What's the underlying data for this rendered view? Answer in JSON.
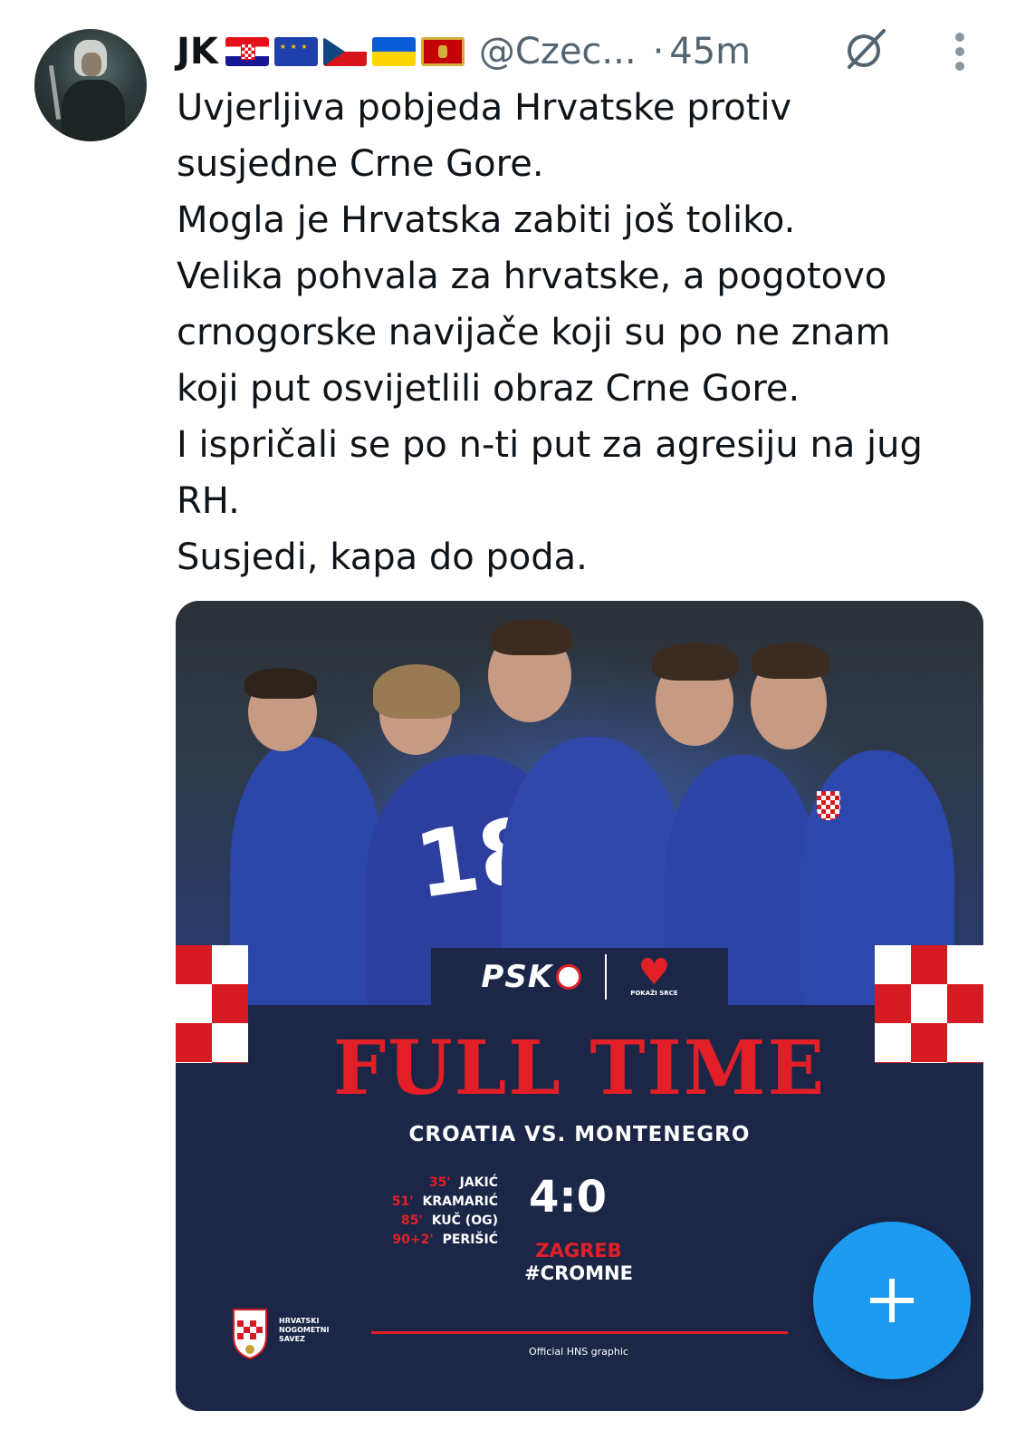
{
  "tweet": {
    "author": {
      "display_name": "JK",
      "flags": [
        "croatia-flag",
        "eu-flag",
        "czech-flag",
        "ukraine-flag",
        "montenegro-flag"
      ],
      "handle": "@Czec...",
      "time_sep": "·",
      "time": "45m"
    },
    "text_lines": [
      "Uvjerljiva pobjeda Hrvatske protiv",
      "susjedne Crne Gore.",
      "Mogla je Hrvatska zabiti još toliko.",
      "Velika pohvala za hrvatske, a pogotovo",
      "crnogorske navijače koji su po ne znam",
      "koji put osvijetlili obraz Crne Gore.",
      "I ispričali se po n-ti put za agresiju na jug",
      "RH.",
      "Susjedi, kapa do poda."
    ]
  },
  "graphic": {
    "sponsor": "PSK",
    "sponsor_sub": "POKAŽI SRCE",
    "headline": "FULL TIME",
    "match": "CROATIA VS. MONTENEGRO",
    "scorers": [
      {
        "min": "35'",
        "name": "JAKIĆ"
      },
      {
        "min": "51'",
        "name": "KRAMARIĆ"
      },
      {
        "min": "85'",
        "name": "KUČ (OG)"
      },
      {
        "min": "90+2'",
        "name": "PERIŠIĆ"
      }
    ],
    "score": "4:0",
    "city": "ZAGREB",
    "hashtag": "#CROMNE",
    "federation": [
      "HRVATSKI",
      "NOGOMETNI",
      "SAVEZ"
    ],
    "footer": "Official HNS graphic",
    "jersey_number": "18"
  },
  "colors": {
    "accent_blue": "#1d9bf0",
    "navy": "#1c2747",
    "red": "#e21f26"
  }
}
